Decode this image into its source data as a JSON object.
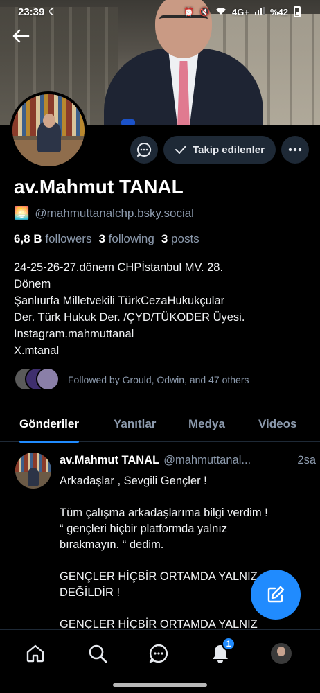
{
  "status_bar": {
    "time": "23:39",
    "icons_right": [
      "alarm-icon",
      "mute-icon",
      "wifi-icon",
      "signal-icon"
    ],
    "network": "4G+",
    "battery": "%42"
  },
  "profile": {
    "name": "av.Mahmut TANAL",
    "handle_emoji": "🌅",
    "handle": "@mahmuttanalchp.bsky.social",
    "followers_count": "6,8 B",
    "followers_label": "followers",
    "following_count": "3",
    "following_label": "following",
    "posts_count": "3",
    "posts_label": "posts",
    "bio_lines": [
      "24-25-26-27.dönem CHPİstanbul MV. 28.",
      "Dönem",
      "Şanlıurfa Milletvekili TürkCezaHukukçular",
      "Der. Türk Hukuk Der. /ÇYD/TÜKODER Üyesi.",
      "Instagram.mahmuttanal",
      "X.mtanal"
    ],
    "followed_by": "Followed by Grould, Odwin, and 47 others"
  },
  "actions": {
    "following_label": "Takip edilenler"
  },
  "tabs": [
    "Gönderiler",
    "Yanıtlar",
    "Medya",
    "Videos"
  ],
  "active_tab": "Gönderiler",
  "post": {
    "author": "av.Mahmut TANAL",
    "handle": "@mahmuttanal...",
    "time": "2sa",
    "lines": [
      "Arkadaşlar , Sevgili Gençler !",
      "",
      "Tüm çalışma arkadaşlarıma bilgi verdim !",
      "“ gençleri hiçbir platformda yalnız",
      "bırakmayın. “ dedim.",
      "",
      "GENÇLER HİÇBİR ORTAMDA YALNIZ",
      "DEĞİLDİR !",
      "",
      "GENÇLER HİÇBİR ORTAMDA YALNIZ"
    ]
  },
  "bottom_nav": {
    "notifications_badge": "1"
  },
  "colors": {
    "accent": "#208bfe",
    "muted_text": "#8c9aad",
    "button_bg": "#1e2936",
    "background": "#000000"
  }
}
